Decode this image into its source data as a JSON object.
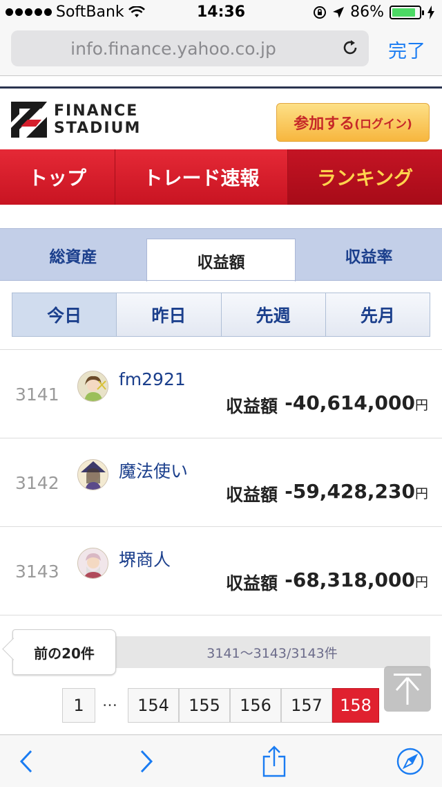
{
  "status_bar": {
    "carrier": "SoftBank",
    "time": "14:36",
    "battery": "86%",
    "battery_level": 0.86
  },
  "url_bar": {
    "url": "info.finance.yahoo.co.jp",
    "done_label": "完了"
  },
  "header": {
    "logo_line1": "FINANCE",
    "logo_line2": "STADIUM",
    "join_label": "参加する",
    "join_sub": "(ログイン)"
  },
  "main_nav": {
    "items": [
      {
        "label": "トップ"
      },
      {
        "label": "トレード速報"
      },
      {
        "label": "ランキング"
      }
    ]
  },
  "category_tabs": {
    "items": [
      {
        "label": "総資産"
      },
      {
        "label": "収益額"
      },
      {
        "label": "収益率"
      }
    ]
  },
  "period_tabs": {
    "items": [
      {
        "label": "今日"
      },
      {
        "label": "昨日"
      },
      {
        "label": "先週"
      },
      {
        "label": "先月"
      }
    ]
  },
  "ranking": {
    "rows": [
      {
        "rank": "3141",
        "name": "fm2921",
        "label": "収益額",
        "amount": "-40,614,000",
        "unit": "円"
      },
      {
        "rank": "3142",
        "name": "魔法使い",
        "label": "収益額",
        "amount": "-59,428,230",
        "unit": "円"
      },
      {
        "rank": "3143",
        "name": "堺商人",
        "label": "収益額",
        "amount": "-68,318,000",
        "unit": "円"
      }
    ]
  },
  "pager": {
    "prev_label": "前の20件",
    "range_text": "3141〜3143/3143件",
    "first_page": "1",
    "ellipsis": "…",
    "pages": [
      "154",
      "155",
      "156",
      "157",
      "158"
    ],
    "current_page": "158"
  },
  "colors": {
    "nav_red": "#d81c2a",
    "active_nav_text": "#ffd34d",
    "link_blue": "#1b3f8c",
    "ios_blue": "#1a7cf2",
    "current_page": "#e0212f"
  }
}
